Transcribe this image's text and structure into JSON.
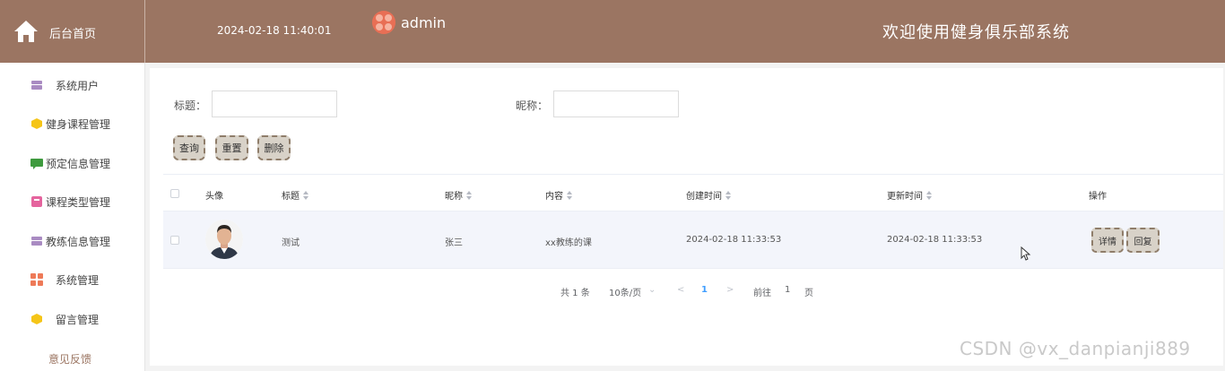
{
  "header": {
    "home_label": "后台首页",
    "datetime": "2024-02-18 11:40:01",
    "username": "admin",
    "welcome": "欢迎使用健身俱乐部系统",
    "bg_color": "#9b7562"
  },
  "sidebar": {
    "items": [
      {
        "label": "系统用户",
        "icon": "folder-icon",
        "color": "#a98bc2"
      },
      {
        "label": "健身课程管理",
        "icon": "cube-icon",
        "color": "#f5c518"
      },
      {
        "label": "预定信息管理",
        "icon": "message-icon",
        "color": "#3e9a3e"
      },
      {
        "label": "课程类型管理",
        "icon": "tag-icon",
        "color": "#e5649e"
      },
      {
        "label": "教练信息管理",
        "icon": "folder-icon",
        "color": "#a98bc2"
      },
      {
        "label": "系统管理",
        "icon": "grid-icon",
        "color": "#ee7a58"
      },
      {
        "label": "留言管理",
        "icon": "cube-icon",
        "color": "#f5c518"
      }
    ],
    "feedback": "意见反馈"
  },
  "filters": {
    "title_label": "标题：",
    "title_value": "",
    "nickname_label": "昵称：",
    "nickname_value": ""
  },
  "actions": {
    "query": "查询",
    "reset": "重置",
    "delete": "删除"
  },
  "table": {
    "columns": [
      "头像",
      "标题",
      "昵称",
      "内容",
      "创建时间",
      "更新时间",
      "操作"
    ],
    "rows": [
      {
        "title": "测试",
        "nickname": "张三",
        "content": "xx教练的课",
        "created": "2024-02-18 11:33:53",
        "updated": "2024-02-18 11:33:53",
        "detail_label": "详情",
        "reply_label": "回复"
      }
    ]
  },
  "pagination": {
    "total": "共 1 条",
    "page_size": "10条/页",
    "current_page": "1",
    "goto_label": "前往",
    "goto_value": "1",
    "page_suffix": "页"
  },
  "watermark": "CSDN @vx_danpianji889"
}
